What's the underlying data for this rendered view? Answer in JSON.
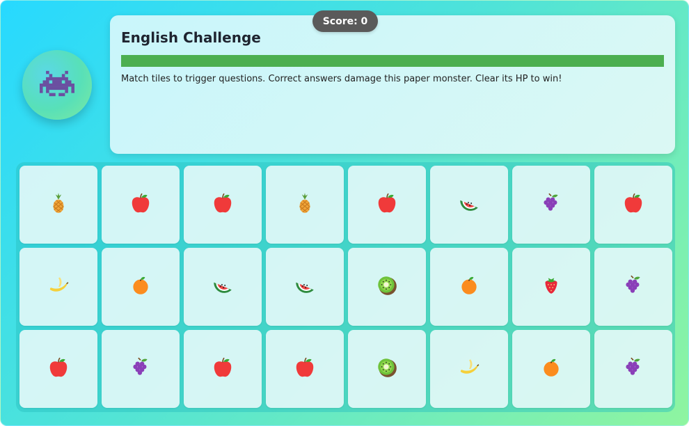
{
  "score": {
    "text": "Score: 0",
    "value": 0
  },
  "monster": {
    "icon": "space-invader-icon",
    "color": "#6b4fa0"
  },
  "panel": {
    "title": "English Challenge",
    "hp_fraction": 1.0,
    "hp_color": "#4caf50",
    "description": "Match tiles to trigger questions. Correct answers damage this paper monster. Clear its HP to win!"
  },
  "board": {
    "columns": 8,
    "rows": 3,
    "tiles": [
      "pineapple",
      "apple",
      "apple",
      "pineapple",
      "apple",
      "watermelon",
      "grapes",
      "apple",
      "banana",
      "orange",
      "watermelon",
      "watermelon",
      "kiwi",
      "orange",
      "strawberry",
      "grapes",
      "apple",
      "grapes",
      "apple",
      "apple",
      "kiwi",
      "banana",
      "orange",
      "grapes"
    ]
  }
}
